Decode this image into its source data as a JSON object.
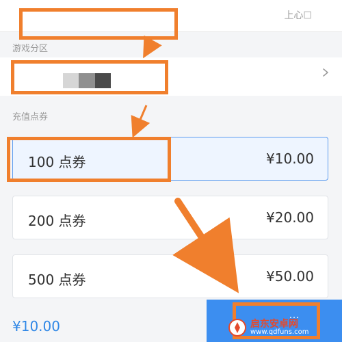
{
  "header": {
    "right_text": "上心☐"
  },
  "sections": {
    "server_label": "游戏分区",
    "topup_label": "充值点券"
  },
  "options": [
    {
      "label": "100 点券",
      "price": "¥10.00",
      "selected": true
    },
    {
      "label": "200 点券",
      "price": "¥20.00",
      "selected": false
    },
    {
      "label": "500 点券",
      "price": "¥50.00",
      "selected": false
    }
  ],
  "footer": {
    "total": "¥10.00",
    "pay_label": "…"
  },
  "watermark": {
    "text": "启东安卓网",
    "url": "www.qdfuns.com"
  },
  "colors": {
    "annotation": "#f07f2d",
    "accent": "#3c8ef0",
    "selected_bg": "#eef5ff",
    "price_blue": "#2f87e6"
  },
  "icons": [
    "chevron-right-icon",
    "arrow-annotation",
    "watermark-logo-icon"
  ]
}
